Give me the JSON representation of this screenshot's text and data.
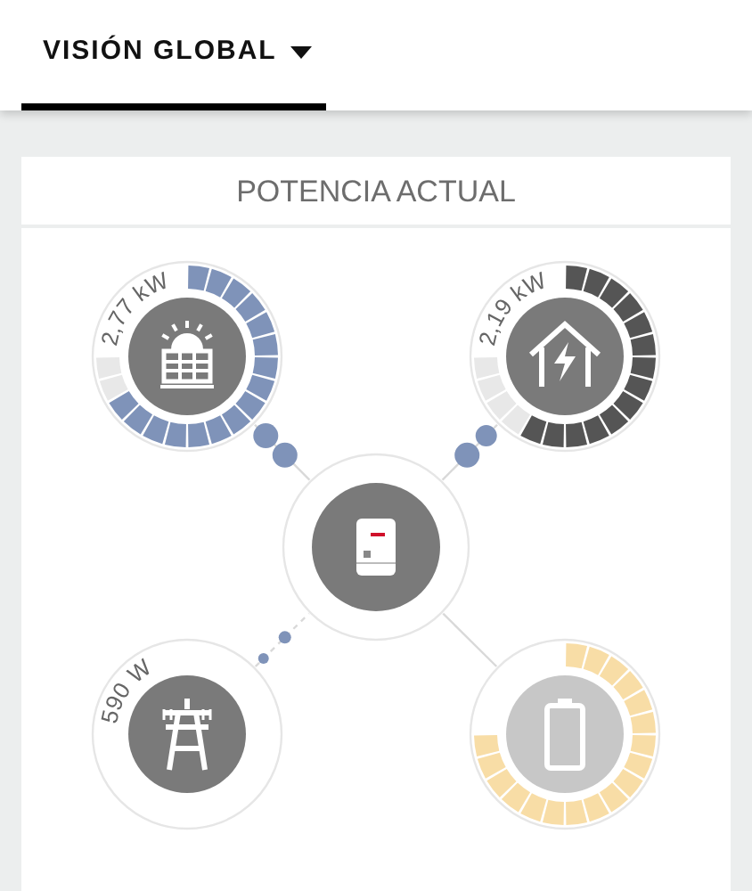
{
  "header": {
    "tabs": [
      {
        "label": "VISIÓN GLOBAL",
        "selected": true
      }
    ]
  },
  "card": {
    "title": "POTENCIA ACTUAL",
    "nodes": [
      {
        "kind": "pv",
        "reading": "2,77 kW",
        "color": "#7f93b9"
      },
      {
        "kind": "load",
        "reading": "2,19 kW",
        "color": "#555555"
      },
      {
        "kind": "inverter"
      },
      {
        "kind": "grid",
        "reading": "590 W"
      },
      {
        "kind": "battery",
        "color": "#f8dda6"
      }
    ]
  }
}
